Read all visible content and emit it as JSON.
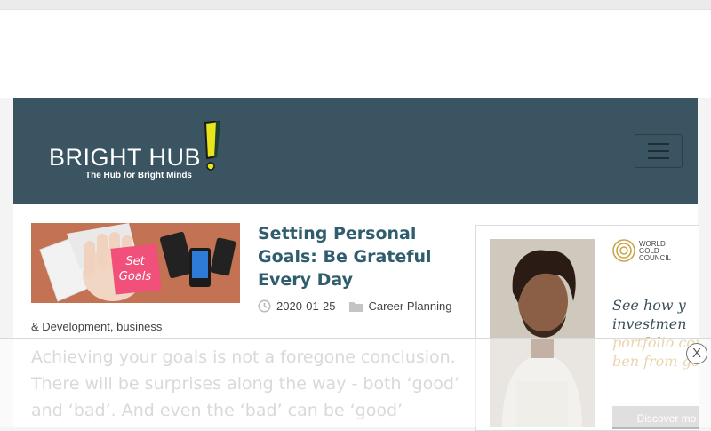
{
  "header": {
    "logo_text": "BRIGHT HUB",
    "tagline": "The Hub for Bright Minds",
    "menu_button_icon": "hamburger-icon",
    "background_color": "#3a5461"
  },
  "article": {
    "title": "Setting Personal Goals: Be Grateful Every Day",
    "thumbnail_note_text": "Set Goals",
    "date": "2020-01-25",
    "categories_line1": "Career Planning",
    "categories_line2": "& Development, business",
    "excerpt": "Achieving your goals is not a foregone conclusion. There will be surprises along the way - both ‘good’ and ‘bad’. And even the ‘bad’ can be ‘good’",
    "title_color": "#2f5d6d",
    "date_icon": "clock-icon",
    "category_icon": "folder-icon"
  },
  "ad": {
    "brand": "WORLD GOLD COUNCIL",
    "brand_lines": [
      "WORLD",
      "GOLD",
      "COUNCIL"
    ],
    "headline_dark": "See how y investmen",
    "headline_gold": "portfolio could ben from gold.",
    "button_label": "Discover mo",
    "accent_color": "#c9a64c"
  },
  "overlay": {
    "close_label": "X"
  }
}
